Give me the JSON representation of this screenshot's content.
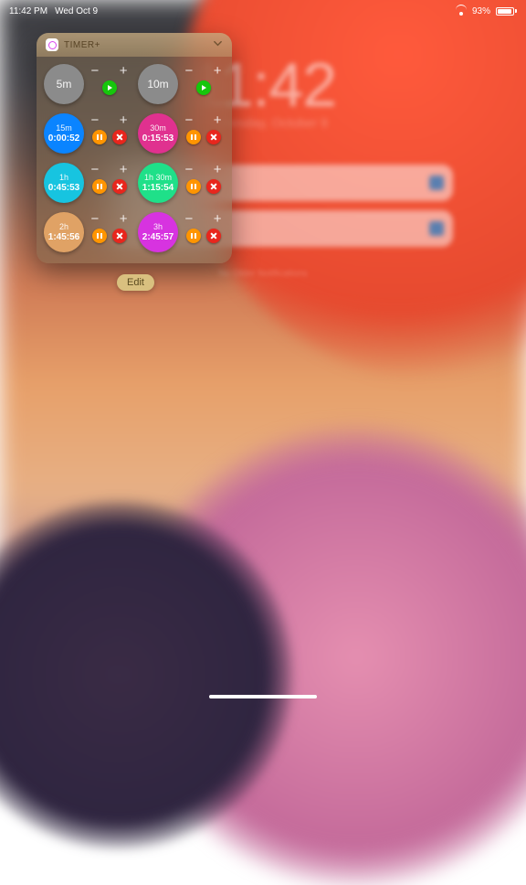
{
  "status": {
    "time": "11:42 PM",
    "date": "Wed Oct 9",
    "battery_pct": "93%",
    "battery_fill": 93
  },
  "lock": {
    "time": "11:42",
    "date": "Wednesday, October 9",
    "no_older": "No Older Notifications"
  },
  "widget": {
    "app": "TIMER+",
    "rows": [
      {
        "left": {
          "label": "5m",
          "elapsed": null,
          "color": "#8b8b8b",
          "running": false
        },
        "right": {
          "label": "10m",
          "elapsed": null,
          "color": "#8b8b8b",
          "running": false
        }
      },
      {
        "left": {
          "label": "15m",
          "elapsed": "0:00:52",
          "color": "#0a84ff",
          "running": true
        },
        "right": {
          "label": "30m",
          "elapsed": "0:15:53",
          "color": "#e0318f",
          "running": true
        }
      },
      {
        "left": {
          "label": "1h",
          "elapsed": "0:45:53",
          "color": "#17c4e0",
          "running": true
        },
        "right": {
          "label": "1h 30m",
          "elapsed": "1:15:54",
          "color": "#1fe089",
          "running": true
        }
      },
      {
        "left": {
          "label": "2h",
          "elapsed": "1:45:56",
          "color": "#e0a265",
          "running": true
        },
        "right": {
          "label": "3h",
          "elapsed": "2:45:57",
          "color": "#d733e0",
          "running": true
        }
      }
    ]
  },
  "edit": "Edit",
  "glyph": {
    "minus": "−",
    "plus": "+"
  }
}
